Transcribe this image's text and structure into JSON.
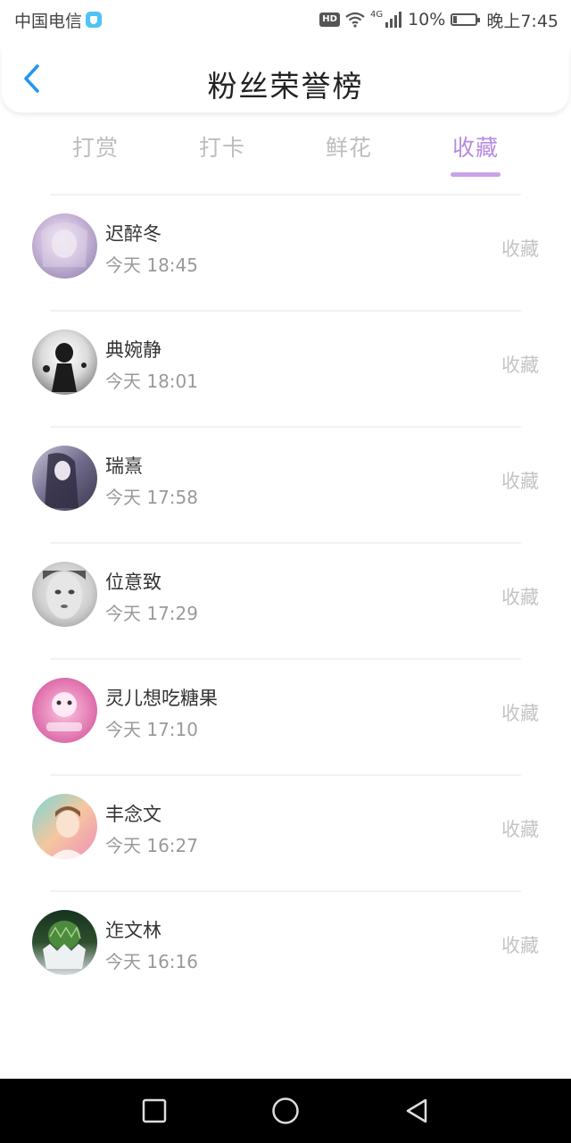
{
  "status_bar": {
    "carrier": "中国电信",
    "hd": "HD",
    "network": "4G",
    "battery": "10%",
    "time": "晚上7:45"
  },
  "header": {
    "title": "粉丝荣誉榜",
    "back_icon": "chevron-left-icon"
  },
  "colors": {
    "accent": "#b58ce0",
    "back": "#2196f3",
    "tab_inactive": "#bdbdbd",
    "muted": "#9a9a9a"
  },
  "tabs": [
    {
      "label": "打赏",
      "active": false
    },
    {
      "label": "打卡",
      "active": false
    },
    {
      "label": "鲜花",
      "active": false
    },
    {
      "label": "收藏",
      "active": true
    }
  ],
  "list": [
    {
      "name": "迟醉冬",
      "time": "今天 18:45",
      "action": "收藏"
    },
    {
      "name": "典婉静",
      "time": "今天 18:01",
      "action": "收藏"
    },
    {
      "name": "瑞熹",
      "time": "今天 17:58",
      "action": "收藏"
    },
    {
      "name": "位意致",
      "time": "今天 17:29",
      "action": "收藏"
    },
    {
      "name": "灵儿想吃糖果",
      "time": "今天 17:10",
      "action": "收藏"
    },
    {
      "name": "丰念文",
      "time": "今天 16:27",
      "action": "收藏"
    },
    {
      "name": "迮文林",
      "time": "今天 16:16",
      "action": "收藏"
    }
  ],
  "nav_bar": {
    "items": [
      "square-recents-icon",
      "circle-home-icon",
      "triangle-back-icon"
    ]
  }
}
